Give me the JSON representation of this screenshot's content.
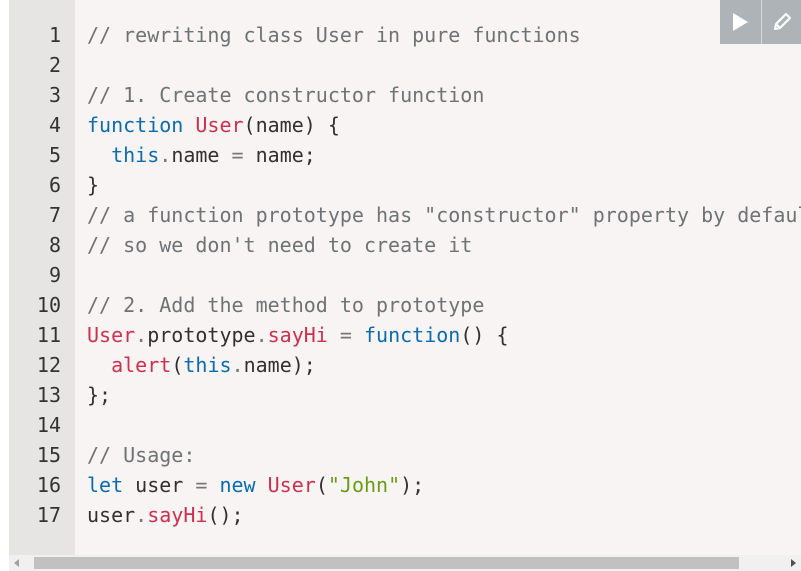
{
  "toolbar": {
    "run_icon": "play-icon",
    "edit_icon": "pencil-icon"
  },
  "colors": {
    "comment": "#6e7376",
    "keyword": "#0a6cb0",
    "function": "#cf2f4f",
    "string": "#689e14",
    "default": "#313130",
    "gutter_bg": "#e7e5e3",
    "editor_bg": "#f7f4f3",
    "toolbar_bg": "#aeb3b8"
  },
  "code": {
    "lines": [
      {
        "num": "1",
        "tokens": [
          {
            "t": "c",
            "v": "// rewriting class User in pure functions"
          }
        ]
      },
      {
        "num": "2",
        "tokens": []
      },
      {
        "num": "3",
        "tokens": [
          {
            "t": "c",
            "v": "// 1. Create constructor function"
          }
        ]
      },
      {
        "num": "4",
        "tokens": [
          {
            "t": "k",
            "v": "function"
          },
          {
            "t": "",
            "v": " "
          },
          {
            "t": "f",
            "v": "User"
          },
          {
            "t": "",
            "v": "(name) {"
          }
        ]
      },
      {
        "num": "5",
        "tokens": [
          {
            "t": "",
            "v": "  "
          },
          {
            "t": "k",
            "v": "this"
          },
          {
            "t": "p",
            "v": "."
          },
          {
            "t": "",
            "v": "name "
          },
          {
            "t": "p",
            "v": "="
          },
          {
            "t": "",
            "v": " name;"
          }
        ]
      },
      {
        "num": "6",
        "tokens": [
          {
            "t": "",
            "v": "}"
          }
        ]
      },
      {
        "num": "7",
        "tokens": [
          {
            "t": "c",
            "v": "// a function prototype has \"constructor\" property by default,"
          }
        ]
      },
      {
        "num": "8",
        "tokens": [
          {
            "t": "c",
            "v": "// so we don't need to create it"
          }
        ]
      },
      {
        "num": "9",
        "tokens": []
      },
      {
        "num": "10",
        "tokens": [
          {
            "t": "c",
            "v": "// 2. Add the method to prototype"
          }
        ]
      },
      {
        "num": "11",
        "tokens": [
          {
            "t": "f",
            "v": "User"
          },
          {
            "t": "p",
            "v": "."
          },
          {
            "t": "",
            "v": "prototype"
          },
          {
            "t": "p",
            "v": "."
          },
          {
            "t": "f",
            "v": "sayHi"
          },
          {
            "t": "",
            "v": " "
          },
          {
            "t": "p",
            "v": "="
          },
          {
            "t": "",
            "v": " "
          },
          {
            "t": "k",
            "v": "function"
          },
          {
            "t": "",
            "v": "() {"
          }
        ]
      },
      {
        "num": "12",
        "tokens": [
          {
            "t": "",
            "v": "  "
          },
          {
            "t": "f",
            "v": "alert"
          },
          {
            "t": "",
            "v": "("
          },
          {
            "t": "k",
            "v": "this"
          },
          {
            "t": "p",
            "v": "."
          },
          {
            "t": "",
            "v": "name);"
          }
        ]
      },
      {
        "num": "13",
        "tokens": [
          {
            "t": "",
            "v": "};"
          }
        ]
      },
      {
        "num": "14",
        "tokens": []
      },
      {
        "num": "15",
        "tokens": [
          {
            "t": "c",
            "v": "// Usage:"
          }
        ]
      },
      {
        "num": "16",
        "tokens": [
          {
            "t": "k",
            "v": "let"
          },
          {
            "t": "",
            "v": " user "
          },
          {
            "t": "p",
            "v": "="
          },
          {
            "t": "",
            "v": " "
          },
          {
            "t": "k",
            "v": "new"
          },
          {
            "t": "",
            "v": " "
          },
          {
            "t": "f",
            "v": "User"
          },
          {
            "t": "",
            "v": "("
          },
          {
            "t": "s",
            "v": "\"John\""
          },
          {
            "t": "",
            "v": ");"
          }
        ]
      },
      {
        "num": "17",
        "tokens": [
          {
            "t": "",
            "v": "user"
          },
          {
            "t": "p",
            "v": "."
          },
          {
            "t": "f",
            "v": "sayHi"
          },
          {
            "t": "",
            "v": "();"
          }
        ]
      }
    ]
  },
  "scrollbar": {
    "left_icon": "scroll-left-arrow-icon",
    "right_icon": "scroll-right-arrow-icon"
  }
}
